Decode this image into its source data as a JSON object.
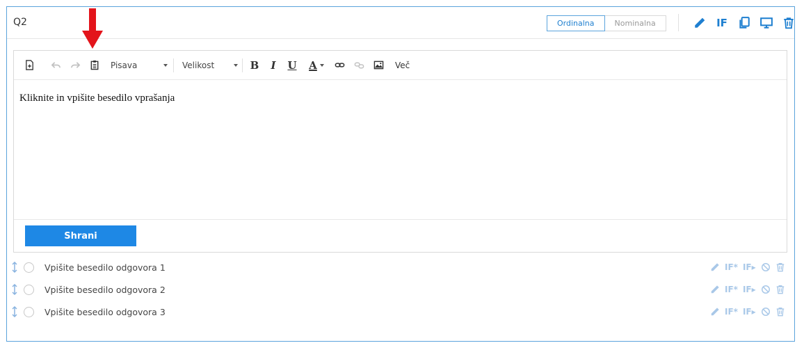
{
  "question": {
    "title": "Q2"
  },
  "scale_toggle": {
    "options": [
      "Ordinalna",
      "Nominalna"
    ],
    "selected": "Ordinalna"
  },
  "header_icons": {
    "if_label": "IF",
    "icons": [
      "pencil-icon",
      "if-icon",
      "copy-icon",
      "monitor-icon",
      "trash-icon"
    ]
  },
  "toolbar": {
    "font_label": "Pisava",
    "size_label": "Velikost",
    "bold": "B",
    "italic": "I",
    "underline": "U",
    "text_color": "A",
    "more_label": "Več"
  },
  "editor": {
    "content": "Kliknite in vpišite besedilo vprašanja"
  },
  "save_label": "Shrani",
  "answers": [
    {
      "label": "Vpišite besedilo odgovora 1"
    },
    {
      "label": "Vpišite besedilo odgovora 2"
    },
    {
      "label": "Vpišite besedilo odgovora 3"
    }
  ],
  "answer_icons": {
    "if_star": "IF*",
    "if_arrow": "IF▸"
  },
  "colors": {
    "accent": "#1e88e5",
    "border": "#5aa3dc",
    "annotation_arrow": "#e3141b"
  }
}
